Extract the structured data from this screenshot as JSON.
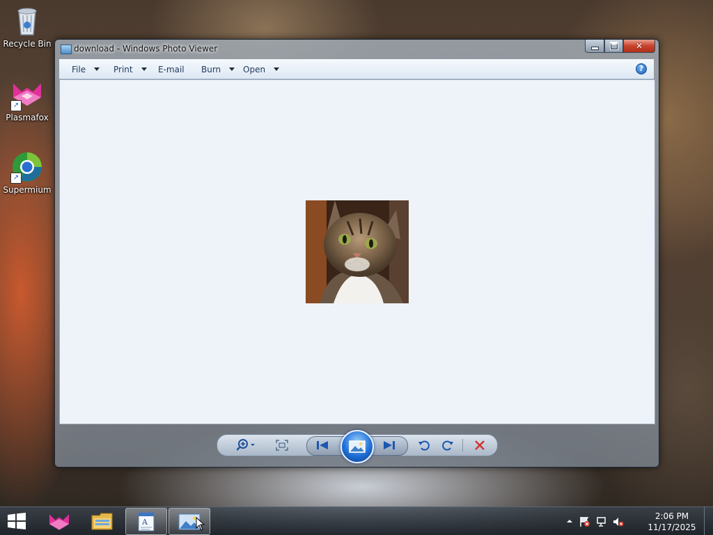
{
  "desktop": {
    "icons": [
      {
        "label": "Recycle Bin"
      },
      {
        "label": "Plasmafox"
      },
      {
        "label": "Supermium"
      }
    ]
  },
  "window": {
    "title": "download - Windows Photo Viewer",
    "menu": {
      "file": "File",
      "print": "Print",
      "email": "E-mail",
      "burn": "Burn",
      "open": "Open"
    }
  },
  "taskbar": {
    "time": "2:06 PM",
    "date": "11/17/2025"
  },
  "icons": {
    "zoom": "magnifier-plus-icon",
    "actual_size": "fit-window-icon",
    "previous": "previous-icon",
    "slideshow": "slideshow-icon",
    "next": "next-icon",
    "rotate_left": "rotate-counterclockwise-icon",
    "rotate_right": "rotate-clockwise-icon",
    "delete": "delete-icon"
  },
  "colors": {
    "viewer_background": "#eef3f9",
    "delete_red": "#d0342c",
    "accent_blue": "#1f6fd6"
  }
}
